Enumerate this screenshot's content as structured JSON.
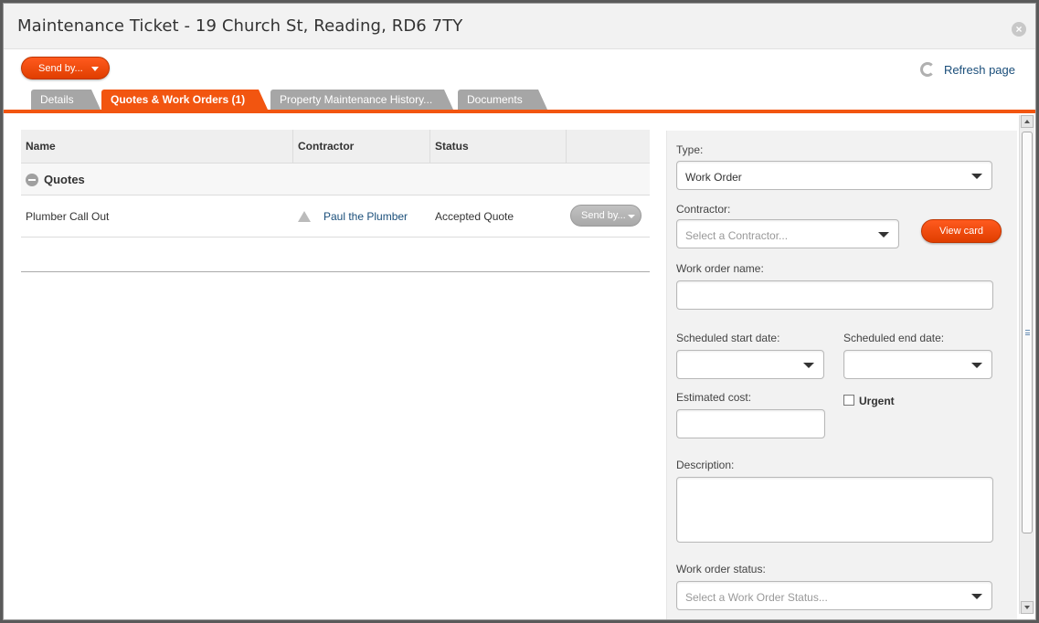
{
  "window": {
    "title": "Maintenance Ticket - 19 Church St, Reading, RD6 7TY",
    "close_glyph": "×"
  },
  "toolbar": {
    "send_label": "Send by...",
    "refresh_label": "Refresh page"
  },
  "tabs": [
    {
      "label": "Details",
      "active": false
    },
    {
      "label": "Quotes & Work Orders (1)",
      "active": true
    },
    {
      "label": "Property Maintenance History...",
      "active": false
    },
    {
      "label": "Documents",
      "active": false
    }
  ],
  "table": {
    "columns": [
      "Name",
      "Contractor",
      "Status",
      ""
    ],
    "group_label": "Quotes",
    "rows": [
      {
        "name": "Plumber Call Out",
        "contractor": "Paul the Plumber",
        "status": "Accepted Quote",
        "action_label": "Send by..."
      }
    ]
  },
  "form": {
    "type_label": "Type:",
    "type_value": "Work Order",
    "contractor_label": "Contractor:",
    "contractor_placeholder": "Select a Contractor...",
    "view_card_label": "View card",
    "work_order_name_label": "Work order name:",
    "work_order_name_value": "",
    "start_date_label": "Scheduled start date:",
    "end_date_label": "Scheduled end date:",
    "estimated_cost_label": "Estimated cost:",
    "estimated_cost_value": "",
    "urgent_label": "Urgent",
    "urgent_checked": false,
    "description_label": "Description:",
    "description_value": "",
    "status_label": "Work order status:",
    "status_placeholder": "Select a Work Order Status..."
  },
  "colors": {
    "accent": "#f25510",
    "link": "#1a4e7a",
    "tab_inactive": "#a6a6a6"
  }
}
